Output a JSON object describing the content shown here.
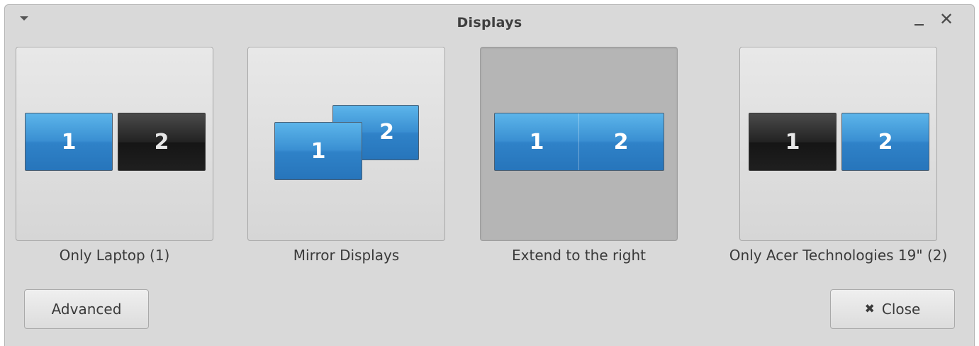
{
  "window": {
    "title": "Displays",
    "menu_icon": "menu-arrow-icon",
    "minimize_icon": "minimize-icon",
    "close_icon_glyph": "✕"
  },
  "options": [
    {
      "label": "Only Laptop (1)",
      "selected": false,
      "monitors": [
        {
          "number": "1",
          "state": "on"
        },
        {
          "number": "2",
          "state": "off"
        }
      ]
    },
    {
      "label": "Mirror Displays",
      "selected": false,
      "monitors": [
        {
          "number": "1",
          "state": "on"
        },
        {
          "number": "2",
          "state": "on"
        }
      ]
    },
    {
      "label": "Extend to the right",
      "selected": true,
      "monitors": [
        {
          "number": "1",
          "state": "on"
        },
        {
          "number": "2",
          "state": "on"
        }
      ]
    },
    {
      "label": "Only Acer Technologies 19\" (2)",
      "selected": false,
      "monitors": [
        {
          "number": "1",
          "state": "off"
        },
        {
          "number": "2",
          "state": "on"
        }
      ]
    }
  ],
  "buttons": {
    "advanced_label": "Advanced",
    "close_label": "Close",
    "close_glyph": "✖"
  },
  "colors": {
    "monitor_on": "#3a8fd2",
    "monitor_off": "#1f1f1f",
    "selected_background": "#b5b5b5",
    "window_background": "#d9d9d9"
  }
}
